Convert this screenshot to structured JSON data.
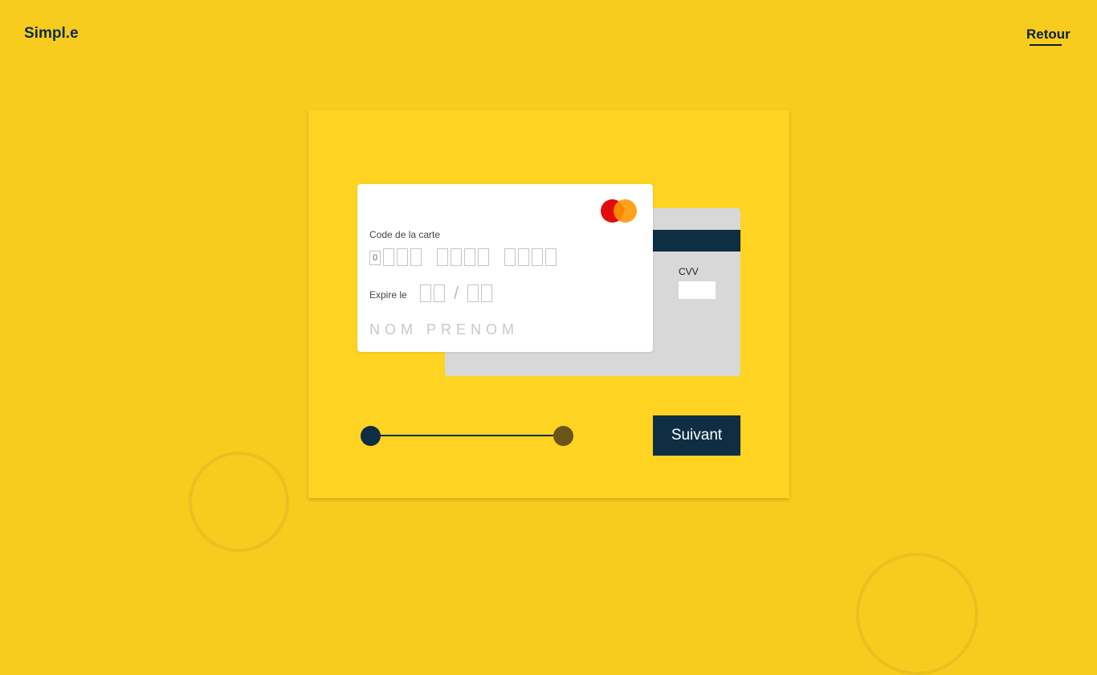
{
  "header": {
    "logo": "Simpl.e",
    "back_link": "Retour"
  },
  "card_front": {
    "code_label": "Code de la carte",
    "first_digit": "0",
    "expiry_label": "Expire le",
    "expiry_separator": "/",
    "name_placeholder": "NOM PRENOM",
    "brand_icon": "mastercard-icon"
  },
  "card_back": {
    "cvv_label": "CVV"
  },
  "progress": {
    "current_step": 1,
    "total_steps": 2
  },
  "actions": {
    "next_label": "Suivant"
  },
  "colors": {
    "background": "#f7cc1e",
    "panel": "#fed321",
    "primary_dark": "#0f2e43",
    "mastercard_red": "#e10c0c",
    "mastercard_orange": "#ff9600"
  }
}
